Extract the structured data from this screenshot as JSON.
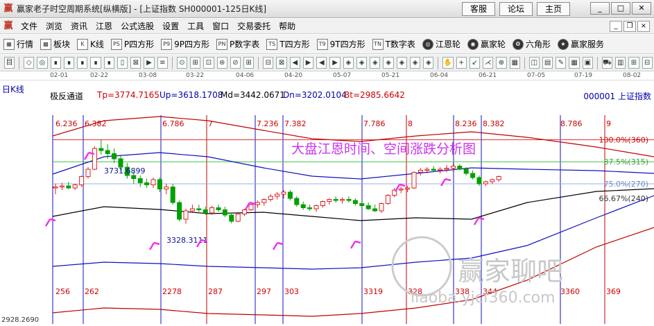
{
  "window": {
    "title": "赢家老子时空周期系统[纵横版] - [上证指数  SH000001-125日K线]",
    "top_links": [
      "客服",
      "论坛",
      "主页"
    ],
    "controls": [
      "_",
      "□",
      "✕"
    ]
  },
  "menu": [
    "文件",
    "浏览",
    "资讯",
    "江恩",
    "公式选股",
    "设置",
    "工具",
    "窗口",
    "交易委托",
    "帮助"
  ],
  "toolbar1": [
    {
      "label": "行情",
      "icon": "grid-icon"
    },
    {
      "label": "板块",
      "icon": "block-icon"
    },
    {
      "label": "K线",
      "icon": "kline-icon"
    },
    {
      "label": "P四方形",
      "icon": "ps-icon"
    },
    {
      "label": "9P四方形",
      "icon": "p9-icon"
    },
    {
      "label": "P数字表",
      "icon": "pn-icon"
    },
    {
      "label": "T四方形",
      "icon": "ts-icon"
    },
    {
      "label": "9T四方形",
      "icon": "t9-icon"
    },
    {
      "label": "T数字表",
      "icon": "tn-icon"
    },
    {
      "label": "江恩轮",
      "icon": "gann-wheel-icon"
    },
    {
      "label": "赢家轮",
      "icon": "winner-wheel-icon"
    },
    {
      "label": "六角形",
      "icon": "hexagon-icon"
    },
    {
      "label": "赢家服务",
      "icon": "service-icon"
    }
  ],
  "toolbar1_icon_text": [
    "▦",
    "▩",
    "K",
    "PS",
    "P9",
    "PN",
    "TS",
    "T9",
    "TN",
    "◎",
    "◉",
    "❂",
    "★"
  ],
  "toolbar2_icons": [
    "目",
    "◇",
    "◎",
    "∎",
    "∎",
    "∎",
    "∎",
    "∎",
    "▯",
    "⊠",
    "▶",
    "≡",
    "⊙",
    "⊞",
    "⊡",
    "⊛",
    "⊘",
    "⊞",
    "⊟",
    "⊠",
    "◀",
    "▶",
    "◀",
    "▶",
    "◈",
    "◈",
    "◈",
    "◈",
    "◈",
    "◈",
    "◈",
    "✋",
    "+",
    "↙",
    "⋌",
    "⊕",
    "▦",
    "◫",
    "▤",
    "✎",
    "▦",
    "▣",
    "⛟",
    "▥",
    "⊞",
    "⊟"
  ],
  "dates": [
    "02-01",
    "02-22",
    "03-08",
    "03-22",
    "04-06",
    "04-20",
    "05-07",
    "05-21",
    "06-04",
    "06-21",
    "07-05",
    "07-19",
    "08-02"
  ],
  "chart_header": {
    "period": "日K线",
    "indicator": "极反通道",
    "tp": "Tp=3774.7165",
    "up": "Up=3618.1708",
    "md": "Md=3442.0671",
    "dn": "Dn=3202.0104",
    "bt": "Bt=2985.6642",
    "code": "000001  上证指数"
  },
  "chart_title": "大盘江恩时间、空间涨跌分析图",
  "price_labels": {
    "high": "3731.6899",
    "low": "3328.3111",
    "bottom": "2928.2690"
  },
  "pct_labels": [
    "100.0%(360)",
    "87.5%(315)",
    "75.0%(270)",
    "66.67%(240)"
  ],
  "time_top_labels": [
    "6.236",
    "6.382",
    "6.786",
    "7",
    "7.236",
    "7.382",
    "7.786",
    "8",
    "8.236",
    "8.382",
    "8.786",
    "9"
  ],
  "time_bottom_labels": [
    "256",
    "262",
    "2278",
    "287",
    "297",
    "303",
    "3319",
    "328",
    "338",
    "344",
    "3360",
    "369"
  ],
  "watermark": {
    "cn": "赢家聊吧",
    "url": "liaoba.yjcf360.com"
  },
  "colors": {
    "bull": "#e02020",
    "bear": "#00a000",
    "arrow": "#ee33ee",
    "title": "#cc33ee",
    "channel": "#c00000",
    "mid": "#000000",
    "inner": "#1010c0"
  },
  "chart_data": {
    "type": "candlestick",
    "title": "大盘江恩时间、空间涨跌分析图",
    "ohlc": [
      [
        3500,
        3520,
        3470,
        3505
      ],
      [
        3505,
        3525,
        3490,
        3510
      ],
      [
        3510,
        3530,
        3495,
        3500
      ],
      [
        3500,
        3520,
        3490,
        3515
      ],
      [
        3515,
        3560,
        3505,
        3555
      ],
      [
        3555,
        3600,
        3545,
        3590
      ],
      [
        3590,
        3700,
        3585,
        3690
      ],
      [
        3690,
        3731,
        3660,
        3680
      ],
      [
        3680,
        3710,
        3640,
        3665
      ],
      [
        3665,
        3690,
        3620,
        3640
      ],
      [
        3640,
        3660,
        3580,
        3600
      ],
      [
        3600,
        3620,
        3545,
        3560
      ],
      [
        3560,
        3580,
        3520,
        3545
      ],
      [
        3545,
        3560,
        3505,
        3525
      ],
      [
        3525,
        3545,
        3500,
        3515
      ],
      [
        3515,
        3550,
        3500,
        3540
      ],
      [
        3540,
        3550,
        3480,
        3495
      ],
      [
        3495,
        3520,
        3470,
        3505
      ],
      [
        3505,
        3520,
        3420,
        3430
      ],
      [
        3430,
        3440,
        3340,
        3350
      ],
      [
        3350,
        3400,
        3328,
        3390
      ],
      [
        3390,
        3420,
        3380,
        3400
      ],
      [
        3400,
        3420,
        3385,
        3395
      ],
      [
        3395,
        3410,
        3370,
        3380
      ],
      [
        3380,
        3415,
        3370,
        3405
      ],
      [
        3405,
        3420,
        3385,
        3395
      ],
      [
        3395,
        3410,
        3360,
        3370
      ],
      [
        3370,
        3380,
        3330,
        3340
      ],
      [
        3340,
        3380,
        3335,
        3375
      ],
      [
        3375,
        3400,
        3365,
        3395
      ],
      [
        3395,
        3430,
        3390,
        3420
      ],
      [
        3420,
        3440,
        3405,
        3430
      ],
      [
        3430,
        3450,
        3415,
        3445
      ],
      [
        3445,
        3470,
        3435,
        3460
      ],
      [
        3460,
        3480,
        3445,
        3470
      ],
      [
        3470,
        3490,
        3450,
        3480
      ],
      [
        3480,
        3490,
        3440,
        3450
      ],
      [
        3450,
        3460,
        3410,
        3420
      ],
      [
        3420,
        3435,
        3395,
        3405
      ],
      [
        3405,
        3420,
        3390,
        3400
      ],
      [
        3400,
        3420,
        3385,
        3415
      ],
      [
        3415,
        3440,
        3405,
        3435
      ],
      [
        3435,
        3450,
        3420,
        3445
      ],
      [
        3445,
        3460,
        3430,
        3440
      ],
      [
        3440,
        3455,
        3425,
        3445
      ],
      [
        3445,
        3460,
        3430,
        3440
      ],
      [
        3440,
        3450,
        3415,
        3425
      ],
      [
        3425,
        3440,
        3405,
        3415
      ],
      [
        3415,
        3430,
        3395,
        3400
      ],
      [
        3400,
        3420,
        3385,
        3390
      ],
      [
        3390,
        3430,
        3380,
        3425
      ],
      [
        3425,
        3470,
        3420,
        3465
      ],
      [
        3465,
        3500,
        3455,
        3490
      ],
      [
        3490,
        3505,
        3475,
        3495
      ],
      [
        3495,
        3510,
        3480,
        3500
      ],
      [
        3500,
        3580,
        3495,
        3575
      ],
      [
        3575,
        3595,
        3560,
        3585
      ],
      [
        3585,
        3600,
        3570,
        3590
      ],
      [
        3590,
        3605,
        3575,
        3585
      ],
      [
        3585,
        3600,
        3570,
        3590
      ],
      [
        3590,
        3610,
        3575,
        3595
      ],
      [
        3595,
        3620,
        3580,
        3605
      ],
      [
        3605,
        3615,
        3585,
        3590
      ],
      [
        3590,
        3600,
        3560,
        3570
      ],
      [
        3570,
        3585,
        3540,
        3550
      ],
      [
        3550,
        3560,
        3510,
        3520
      ],
      [
        3520,
        3535,
        3510,
        3530
      ],
      [
        3530,
        3545,
        3520,
        3540
      ],
      [
        3540,
        3560,
        3530,
        3555
      ]
    ],
    "ylim": [
      2900,
      3850
    ],
    "channels": {
      "tp": 3774.7165,
      "up": 3618.1708,
      "md": 3442.0671,
      "dn": 3202.0104,
      "bt": 2985.6642
    },
    "levels": [
      {
        "label": "100.0%(360)",
        "value": 3731.69
      },
      {
        "label": "87.5%(315)",
        "value": 3626
      },
      {
        "label": "75.0%(270)",
        "value": 3520
      },
      {
        "label": "66.67%(240)",
        "value": 3450
      }
    ]
  }
}
